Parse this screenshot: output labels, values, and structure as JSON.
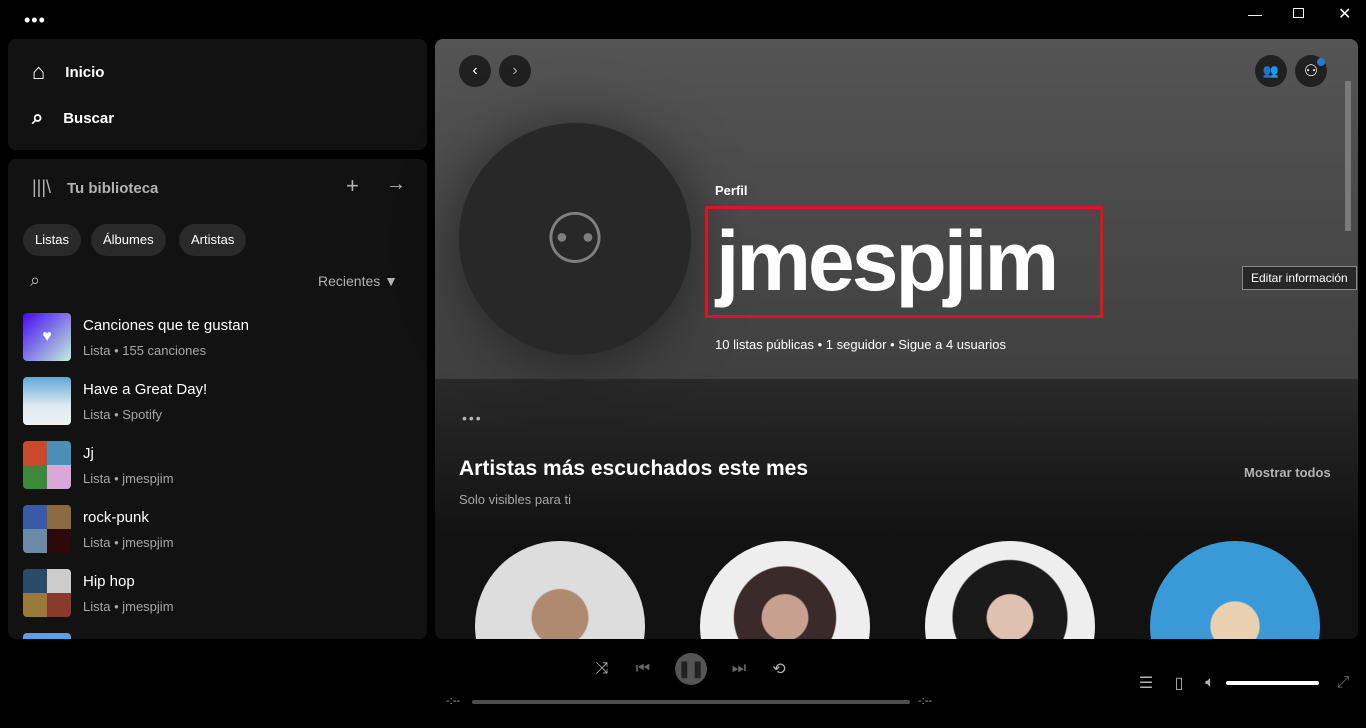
{
  "window": {
    "menu_icon": "more-horizontal-icon"
  },
  "nav": {
    "home": "Inicio",
    "search": "Buscar"
  },
  "library": {
    "title": "Tu biblioteca",
    "chips": [
      "Listas",
      "Álbumes",
      "Artistas"
    ],
    "sort": "Recientes",
    "items": [
      {
        "title": "Canciones que te gustan",
        "subtitle": "Lista • 155 canciones"
      },
      {
        "title": "Have a Great Day!",
        "subtitle": "Lista • Spotify"
      },
      {
        "title": "Jj",
        "subtitle": "Lista • jmespjim"
      },
      {
        "title": "rock-punk",
        "subtitle": "Lista • jmespjim"
      },
      {
        "title": "Hip hop",
        "subtitle": "Lista • jmespjim"
      }
    ]
  },
  "profile": {
    "type": "Perfil",
    "name": "jmespjim",
    "stats": "10 listas públicas • 1 seguidor • Sigue a 4 usuarios",
    "edit": "Editar información",
    "highlight_color": "#e0141e"
  },
  "section": {
    "title": "Artistas más escuchados este mes",
    "subtitle": "Solo visibles para ti",
    "show_all": "Mostrar todos"
  },
  "player": {
    "elapsed": "-:--",
    "duration": "-:--",
    "volume_percent": 100,
    "progress_percent": 0
  }
}
